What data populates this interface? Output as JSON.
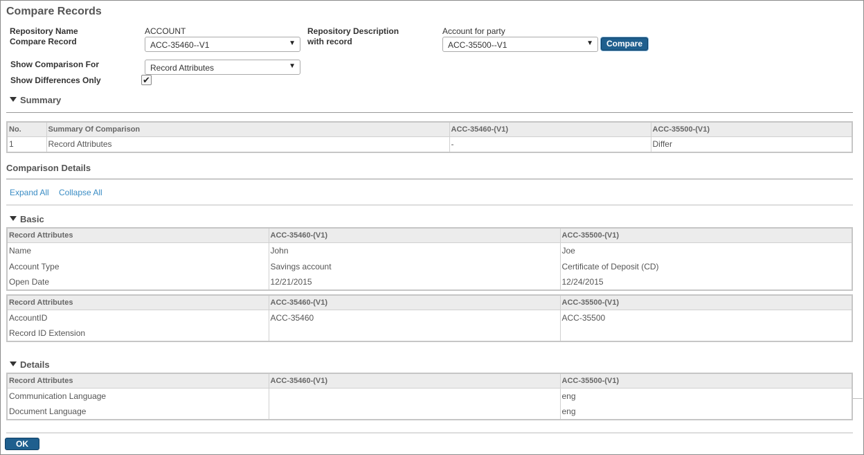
{
  "page": {
    "title": "Compare Records"
  },
  "form": {
    "repo_name_label": "Repository Name",
    "repo_name_value": "ACCOUNT",
    "compare_record_label": "Compare Record",
    "compare_record_value": "ACC-35460--V1",
    "repo_desc_label": "Repository Description",
    "repo_desc_value": "Account for party",
    "with_record_label": "with record",
    "with_record_value": "ACC-35500--V1",
    "compare_button": "Compare",
    "show_comparison_label": "Show Comparison For",
    "show_comparison_value": "Record Attributes",
    "show_diff_label": "Show Differences Only",
    "show_diff_checked": true
  },
  "summary": {
    "heading": "Summary",
    "columns": [
      "No.",
      "Summary Of Comparison",
      "ACC-35460-(V1)",
      "ACC-35500-(V1)"
    ],
    "rows": [
      [
        "1",
        "Record Attributes",
        "-",
        "Differ"
      ]
    ]
  },
  "details": {
    "heading": "Comparison Details",
    "expand_all": "Expand All",
    "collapse_all": "Collapse All",
    "basic": {
      "heading": "Basic",
      "tables": [
        {
          "columns": [
            "Record Attributes",
            "ACC-35460-(V1)",
            "ACC-35500-(V1)"
          ],
          "rows": [
            [
              "Name",
              "John",
              "Joe"
            ],
            [
              "Account Type",
              "Savings account",
              "Certificate of Deposit (CD)"
            ],
            [
              "Open Date",
              "12/21/2015",
              "12/24/2015"
            ]
          ]
        },
        {
          "columns": [
            "Record Attributes",
            "ACC-35460-(V1)",
            "ACC-35500-(V1)"
          ],
          "rows": [
            [
              "AccountID",
              "ACC-35460",
              "ACC-35500"
            ],
            [
              "Record ID Extension",
              "",
              ""
            ]
          ]
        }
      ]
    },
    "details_section": {
      "heading": "Details",
      "columns": [
        "Record Attributes",
        "ACC-35460-(V1)",
        "ACC-35500-(V1)"
      ],
      "rows": [
        [
          "Communication Language",
          "",
          "eng"
        ],
        [
          "Document Language",
          "",
          "eng"
        ]
      ]
    }
  },
  "footer": {
    "ok_button": "OK"
  },
  "icons": {
    "checkbox": "check-icon",
    "dropdown": "chevron-down-icon",
    "collapse": "triangle-down-icon"
  },
  "colors": {
    "button_bg": "#1f5f8e",
    "link": "#3a8cc4"
  }
}
